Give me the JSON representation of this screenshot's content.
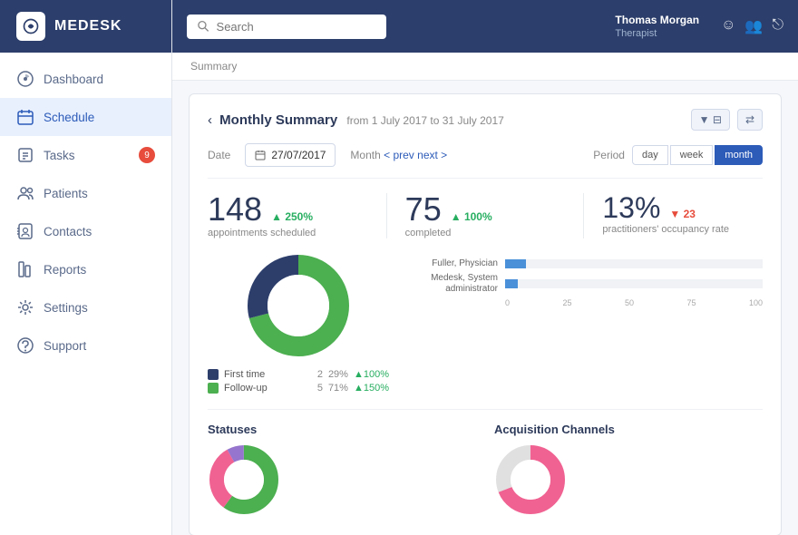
{
  "logo": {
    "text": "MEDESK"
  },
  "sidebar": {
    "items": [
      {
        "id": "dashboard",
        "label": "Dashboard",
        "icon": "dashboard-icon",
        "active": false
      },
      {
        "id": "schedule",
        "label": "Schedule",
        "icon": "schedule-icon",
        "active": true
      },
      {
        "id": "tasks",
        "label": "Tasks",
        "icon": "tasks-icon",
        "active": false,
        "badge": "9"
      },
      {
        "id": "patients",
        "label": "Patients",
        "icon": "patients-icon",
        "active": false
      },
      {
        "id": "contacts",
        "label": "Contacts",
        "icon": "contacts-icon",
        "active": false
      },
      {
        "id": "reports",
        "label": "Reports",
        "icon": "reports-icon",
        "active": false
      },
      {
        "id": "settings",
        "label": "Settings",
        "icon": "settings-icon",
        "active": false
      },
      {
        "id": "support",
        "label": "Support",
        "icon": "support-icon",
        "active": false
      }
    ]
  },
  "header": {
    "search_placeholder": "Search",
    "user_name": "Thomas Morgan",
    "user_role": "Therapist"
  },
  "breadcrumb": "Summary",
  "summary": {
    "title": "Monthly Summary",
    "date_range": "from 1 July 2017 to 31 July 2017",
    "date_value": "27/07/2017",
    "period_options": [
      "day",
      "week",
      "month"
    ],
    "active_period": "month",
    "month_nav": "Month",
    "prev_label": "< prev",
    "next_label": "next >",
    "stats": {
      "appointments": {
        "number": "148",
        "change": "250%",
        "direction": "up",
        "label": "appointments scheduled"
      },
      "completed": {
        "number": "75",
        "change": "100%",
        "direction": "up",
        "label": "completed"
      },
      "occupancy": {
        "percent": "13%",
        "change": "23",
        "direction": "down",
        "label": "practitioners' occupancy rate"
      }
    },
    "donut_data": {
      "segments": [
        {
          "label": "First time",
          "color": "#2d3e6b",
          "value": 2,
          "percent": "29%",
          "change": "100%",
          "change_dir": "up"
        },
        {
          "label": "Follow-up",
          "color": "#4caf50",
          "value": 5,
          "percent": "71%",
          "change": "150%",
          "change_dir": "up"
        }
      ]
    },
    "bar_chart": {
      "rows": [
        {
          "label": "Fuller, Physician",
          "value": 8,
          "max": 100
        },
        {
          "label": "Medesk, System administrator",
          "value": 5,
          "max": 100
        }
      ],
      "axis": [
        "0",
        "25",
        "50",
        "75",
        "100"
      ]
    },
    "statuses_title": "Statuses",
    "acquisition_title": "Acquisition Channels"
  }
}
